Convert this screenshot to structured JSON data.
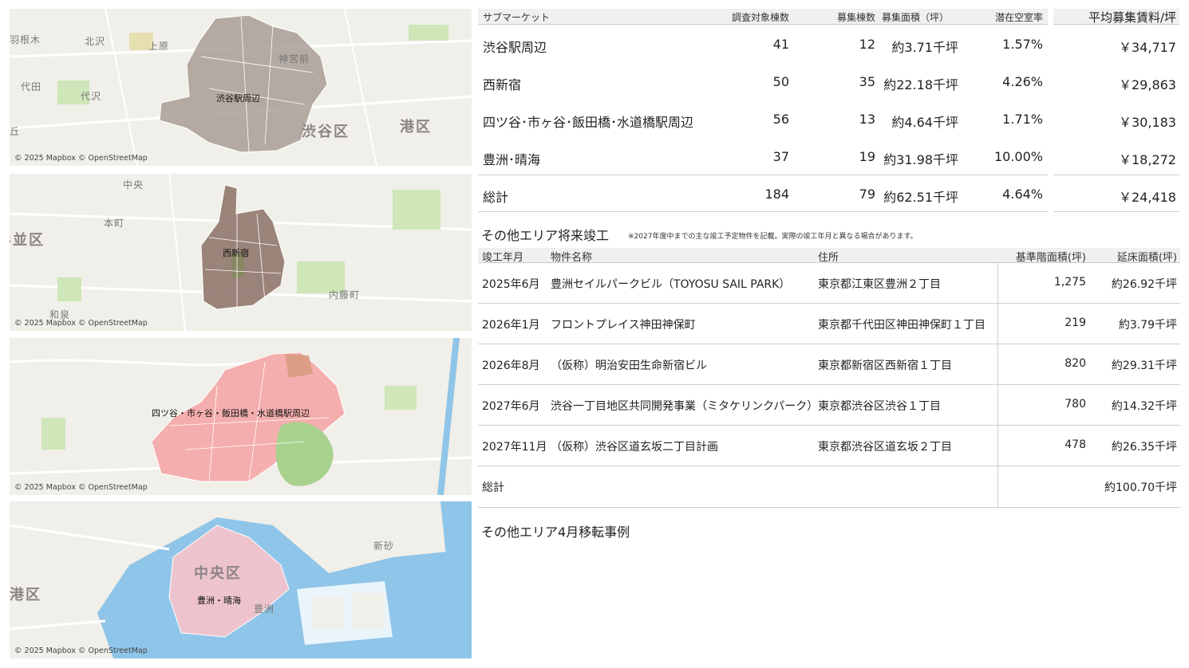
{
  "maps": [
    {
      "area_label": "渋谷駅周辺",
      "place_labels": [
        "羽根木",
        "北沢",
        "上原",
        "代田",
        "代沢",
        "神宮前",
        "丘"
      ],
      "district_labels": [
        "渋谷区",
        "港区"
      ],
      "credit": "© 2025 Mapbox © OpenStreetMap",
      "color": "#a59890"
    },
    {
      "area_label": "西新宿",
      "place_labels": [
        "中央",
        "本町",
        "内藤町",
        "和泉"
      ],
      "district_labels": [
        "杉並区"
      ],
      "credit": "© 2025 Mapbox © OpenStreetMap",
      "color": "#8b7065"
    },
    {
      "area_label": "四ツ谷・市ヶ谷・飯田橋・水道橋駅周辺",
      "place_labels": [],
      "district_labels": [],
      "credit": "© 2025 Mapbox © OpenStreetMap",
      "color": "#f4a6a6"
    },
    {
      "area_label": "豊洲・晴海",
      "place_labels": [
        "新砂",
        "豊洲"
      ],
      "district_labels": [
        "中央区",
        "港区"
      ],
      "credit": "© 2025 Mapbox © OpenStreetMap",
      "color": "#f2c4cc"
    }
  ],
  "submarket": {
    "headers": [
      "サブマーケット",
      "調査対象棟数",
      "募集棟数",
      "募集面積（坪）",
      "潜在空室率"
    ],
    "rows": [
      {
        "name": "渋谷駅周辺",
        "surveyed": "41",
        "listed": "12",
        "area": "約3.71千坪",
        "vacancy": "1.57%"
      },
      {
        "name": "西新宿",
        "surveyed": "50",
        "listed": "35",
        "area": "約22.18千坪",
        "vacancy": "4.26%"
      },
      {
        "name": "四ツ谷･市ヶ谷･飯田橋･水道橋駅周辺",
        "surveyed": "56",
        "listed": "13",
        "area": "約4.64千坪",
        "vacancy": "1.71%"
      },
      {
        "name": "豊洲･晴海",
        "surveyed": "37",
        "listed": "19",
        "area": "約31.98千坪",
        "vacancy": "10.00%"
      }
    ],
    "total": {
      "name": "総計",
      "surveyed": "184",
      "listed": "79",
      "area": "約62.51千坪",
      "vacancy": "4.64%"
    }
  },
  "rent": {
    "header": "平均募集賃料/坪",
    "values": [
      "￥34,717",
      "￥29,863",
      "￥30,183",
      "￥18,272"
    ],
    "total": "￥24,418"
  },
  "future": {
    "title": "その他エリア将来竣工",
    "note": "※2027年度中までの主な竣工予定物件を記載。実際の竣工年月と異なる場合があります。",
    "headers": [
      "竣工年月",
      "物件名称",
      "住所",
      "基準階面積(坪)",
      "延床面積(坪)"
    ],
    "rows": [
      {
        "date": "2025年6月",
        "name": "豊洲セイルパークビル（TOYOSU SAIL PARK）",
        "address": "東京都江東区豊洲２丁目",
        "floor": "1,275",
        "total": "約26.92千坪"
      },
      {
        "date": "2026年1月",
        "name": "フロントプレイス神田神保町",
        "address": "東京都千代田区神田神保町１丁目",
        "floor": "219",
        "total": "約3.79千坪"
      },
      {
        "date": "2026年8月",
        "name": "（仮称）明治安田生命新宿ビル",
        "address": "東京都新宿区西新宿１丁目",
        "floor": "820",
        "total": "約29.31千坪"
      },
      {
        "date": "2027年6月",
        "name": "渋谷一丁目地区共同開発事業（ミタケリンクパーク）",
        "address": "東京都渋谷区渋谷１丁目",
        "floor": "780",
        "total": "約14.32千坪"
      },
      {
        "date": "2027年11月",
        "name": "（仮称）渋谷区道玄坂二丁目計画",
        "address": "東京都渋谷区道玄坂２丁目",
        "floor": "478",
        "total": "約26.35千坪"
      }
    ],
    "total_label": "総計",
    "total_value": "約100.70千坪"
  },
  "relocation": {
    "title": "その他エリア4月移転事例"
  }
}
